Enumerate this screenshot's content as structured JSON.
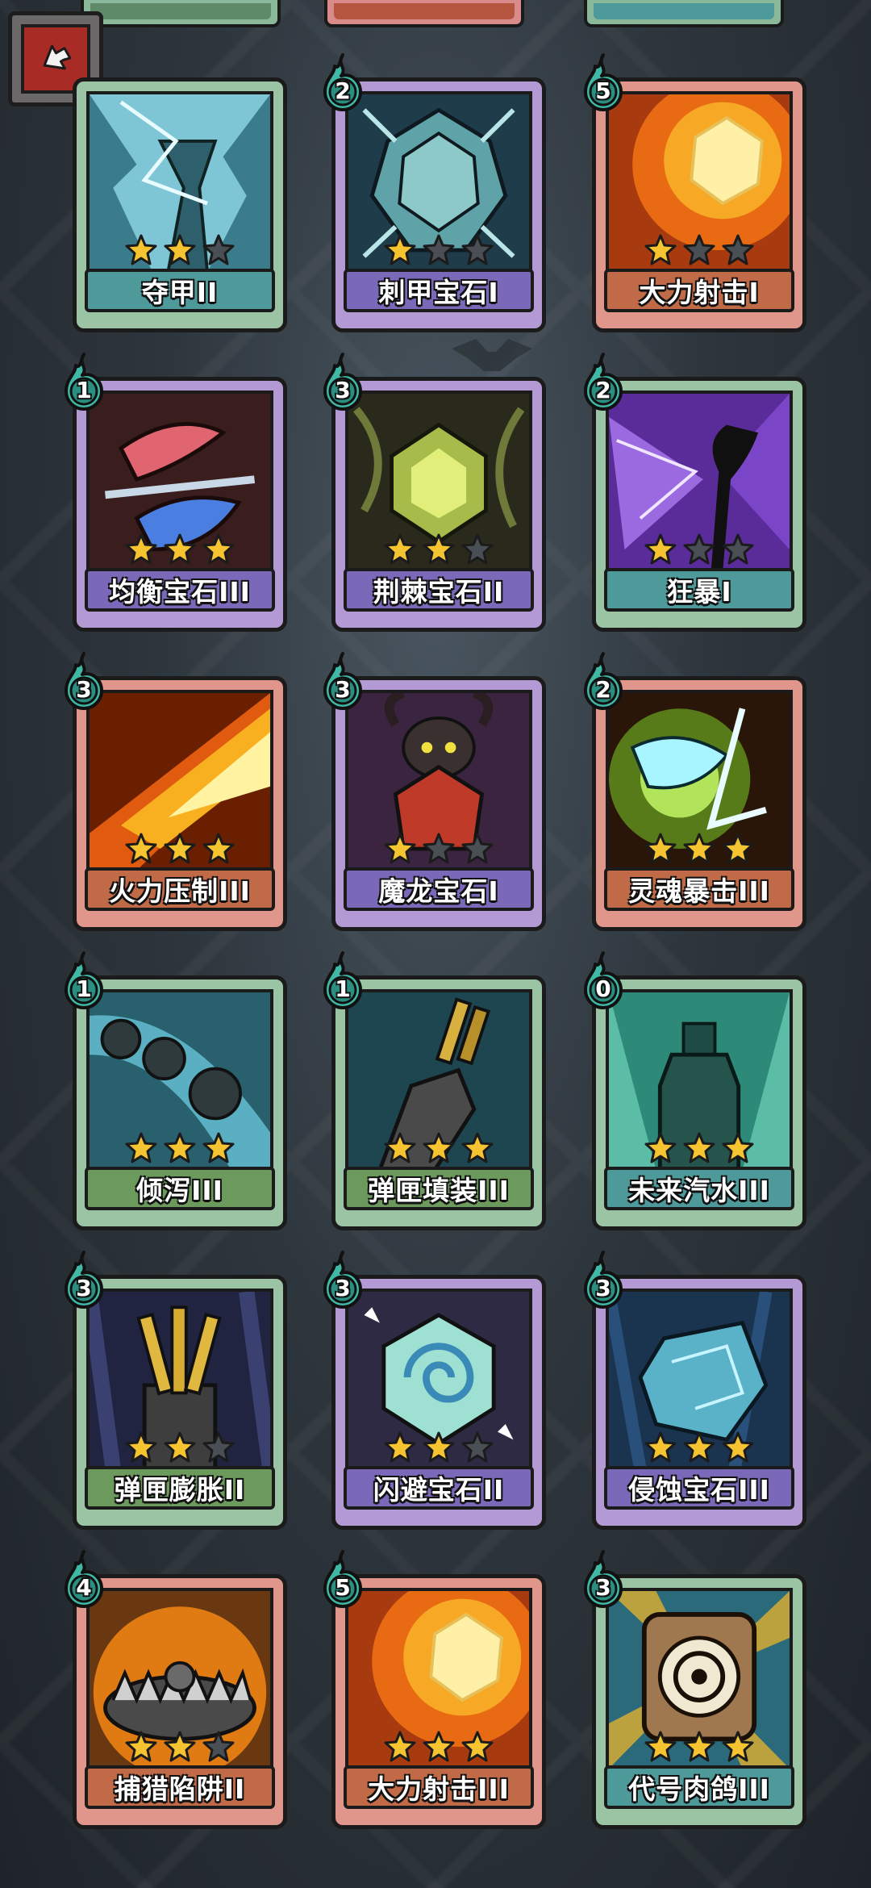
{
  "screen": {
    "back_button": {
      "icon": "return-arrow-icon"
    }
  },
  "top_partial_row": [
    {
      "frame_color": "#8ab89a",
      "label_color": "#5e8a6a"
    },
    {
      "frame_color": "#d98a8a",
      "label_color": "#b5553f"
    },
    {
      "frame_color": "#8ab89a",
      "label_color": "#4e9a9a"
    }
  ],
  "cards": [
    {
      "name": "夺甲II",
      "cost": "",
      "stars": 2,
      "frame": "#9bc4a4",
      "label_bg": "#4e9a9a",
      "art": "armor-shatter"
    },
    {
      "name": "刺甲宝石I",
      "cost": "2",
      "stars": 1,
      "frame": "#b49ad4",
      "label_bg": "#7a68b8",
      "art": "spike-gem"
    },
    {
      "name": "大力射击I",
      "cost": "5",
      "stars": 1,
      "frame": "#e0968a",
      "label_bg": "#c06a48",
      "art": "fire-blast"
    },
    {
      "name": "均衡宝石III",
      "cost": "1",
      "stars": 3,
      "frame": "#b49ad4",
      "label_bg": "#7a68b8",
      "art": "balance-gem"
    },
    {
      "name": "荆棘宝石II",
      "cost": "3",
      "stars": 2,
      "frame": "#b49ad4",
      "label_bg": "#7a68b8",
      "art": "thorn-gem"
    },
    {
      "name": "狂暴I",
      "cost": "2",
      "stars": 1,
      "frame": "#9bc4a4",
      "label_bg": "#4e9a9a",
      "art": "berserk"
    },
    {
      "name": "火力压制III",
      "cost": "3",
      "stars": 3,
      "frame": "#e0968a",
      "label_bg": "#c06a48",
      "art": "firepower"
    },
    {
      "name": "魔龙宝石I",
      "cost": "3",
      "stars": 1,
      "frame": "#b49ad4",
      "label_bg": "#7a68b8",
      "art": "dragon-gem"
    },
    {
      "name": "灵魂暴击III",
      "cost": "2",
      "stars": 3,
      "frame": "#e0968a",
      "label_bg": "#c06a48",
      "art": "soul-crit"
    },
    {
      "name": "倾泻III",
      "cost": "1",
      "stars": 3,
      "frame": "#9bc4a4",
      "label_bg": "#6c9a5c",
      "art": "pour"
    },
    {
      "name": "弹匣填装III",
      "cost": "1",
      "stars": 3,
      "frame": "#9bc4a4",
      "label_bg": "#6c9a5c",
      "art": "reload"
    },
    {
      "name": "未来汽水III",
      "cost": "0",
      "stars": 3,
      "frame": "#9bc4a4",
      "label_bg": "#4e9a9a",
      "art": "soda"
    },
    {
      "name": "弹匣膨胀II",
      "cost": "3",
      "stars": 2,
      "frame": "#9bc4a4",
      "label_bg": "#6c9a5c",
      "art": "mag-expand"
    },
    {
      "name": "闪避宝石II",
      "cost": "3",
      "stars": 2,
      "frame": "#b49ad4",
      "label_bg": "#7a68b8",
      "art": "dodge-gem"
    },
    {
      "name": "侵蚀宝石III",
      "cost": "3",
      "stars": 3,
      "frame": "#b49ad4",
      "label_bg": "#7a68b8",
      "art": "erosion-gem"
    },
    {
      "name": "捕猎陷阱II",
      "cost": "4",
      "stars": 2,
      "frame": "#e0968a",
      "label_bg": "#c06a48",
      "art": "trap"
    },
    {
      "name": "大力射击III",
      "cost": "5",
      "stars": 3,
      "frame": "#e0968a",
      "label_bg": "#c06a48",
      "art": "fire-blast"
    },
    {
      "name": "代号肉鸽III",
      "cost": "3",
      "stars": 3,
      "frame": "#9bc4a4",
      "label_bg": "#4e9a9a",
      "art": "codename"
    }
  ]
}
